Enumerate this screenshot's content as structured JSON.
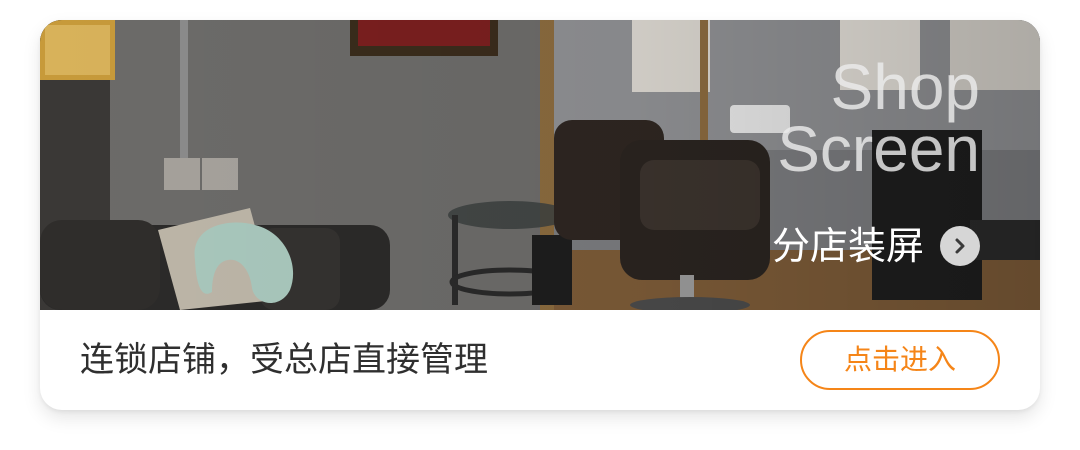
{
  "card": {
    "headline_line1": "Shop",
    "headline_line2": "Screen",
    "subtitle": "分店装屏",
    "arrow_icon": "chevron-right-icon",
    "description": "连锁店铺，受总店直接管理",
    "enter_button": "点击进入"
  },
  "colors": {
    "accent": "#f58518",
    "text_dark": "#2f2f2f",
    "card_bg": "#ffffff"
  }
}
